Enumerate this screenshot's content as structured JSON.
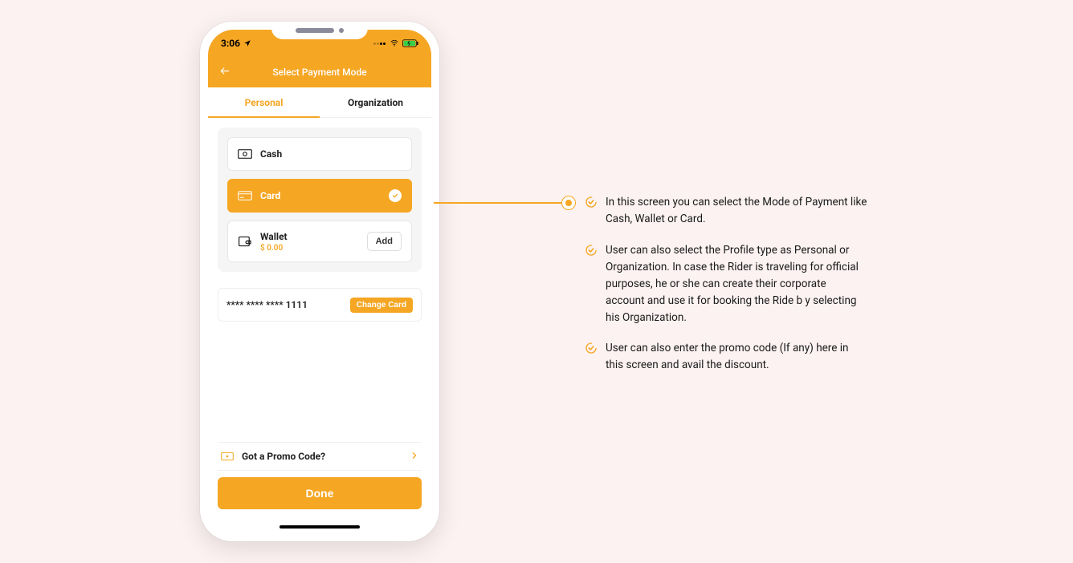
{
  "statusbar": {
    "time": "3:06"
  },
  "navbar": {
    "title": "Select Payment Mode"
  },
  "tabs": {
    "personal": "Personal",
    "organization": "Organization"
  },
  "options": {
    "cash": "Cash",
    "card": "Card",
    "wallet": "Wallet",
    "wallet_balance": "$ 0.00",
    "add": "Add"
  },
  "card_row": {
    "masked": "**** **** **** 1111",
    "change": "Change Card"
  },
  "promo": {
    "label": "Got a Promo Code?"
  },
  "done": "Done",
  "annotations": [
    "In this screen you can select the Mode of Payment like Cash, Wallet or Card.",
    "User can also select the Profile type as Personal or Organization. In case the Rider is traveling for official purposes, he or she can create their corporate account and use it for booking the Ride b y selecting his Organization.",
    "User can also enter the promo code (If any) here in this screen and avail the discount."
  ]
}
